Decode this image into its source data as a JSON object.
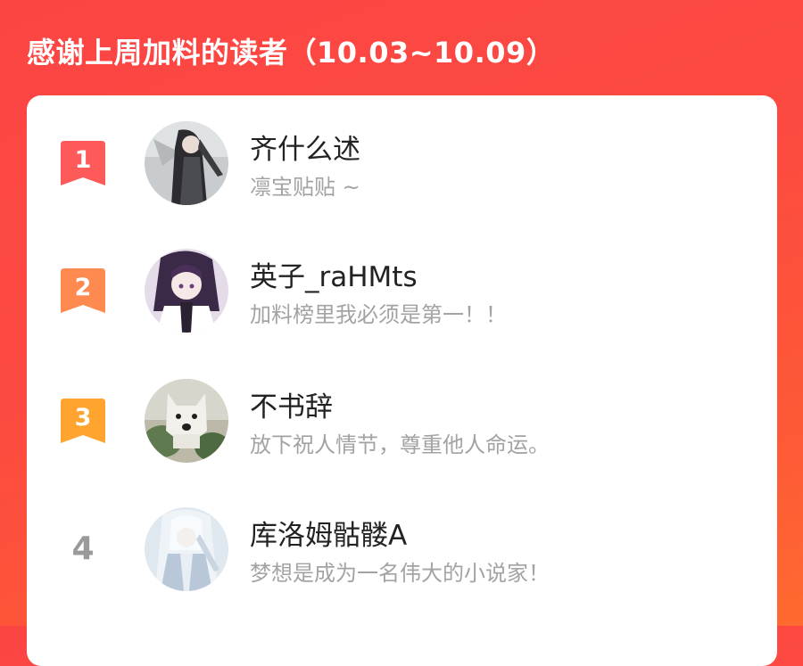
{
  "header": {
    "title": "感谢上周加料的读者（10.03~10.09）"
  },
  "readers": [
    {
      "rank": "1",
      "name": "齐什么述",
      "message": "凛宝贴贴 ~",
      "badge_color": "#ff5a5a"
    },
    {
      "rank": "2",
      "name": "英子_raHMts",
      "message": "加料榜里我必须是第一！！",
      "badge_color": "#ff8a50"
    },
    {
      "rank": "3",
      "name": "不书辞",
      "message": "放下祝人情节，尊重他人命运。",
      "badge_color": "#ffa42e"
    },
    {
      "rank": "4",
      "name": "库洛姆骷髅A",
      "message": "梦想是成为一名伟大的小说家！"
    }
  ],
  "colors": {
    "background": "#fd4a40",
    "card": "#ffffff",
    "name_text": "#222222",
    "message_text": "#a3a3a3",
    "plain_rank": "#9a9a9a"
  }
}
